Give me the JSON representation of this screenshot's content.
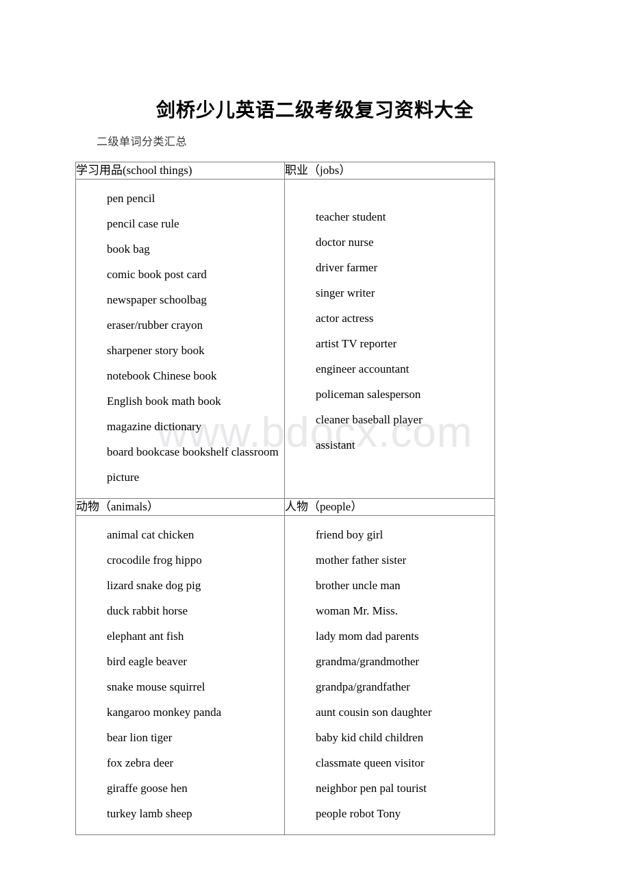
{
  "document": {
    "title": "剑桥少儿英语二级考级复习资料大全",
    "subtitle": "二级单词分类汇总",
    "watermark": "www.bdocx.com"
  },
  "table": {
    "sections": [
      {
        "left": {
          "heading": "学习用品(school things)",
          "words": [
            "pen    pencil",
            "pencil case        rule",
            "book        bag",
            "comic book post card",
            "newspaper     schoolbag",
            "eraser/rubber     crayon",
            "sharpener     story book",
            "notebook Chinese book",
            "English book math book",
            "magazine dictionary",
            "board bookcase bookshelf classroom picture"
          ]
        },
        "right": {
          "heading": "职业（jobs）",
          "words": [
            "teacher    student",
            "doctor    nurse",
            "driver    farmer",
            "singer writer",
            "actor    actress",
            "artist    TV reporter",
            "engineer     accountant",
            "policeman salesperson",
            "cleaner     baseball player",
            "assistant"
          ]
        }
      },
      {
        "left": {
          "heading": "动物（animals）",
          "words": [
            "animal cat    chicken",
            "crocodile frog hippo",
            "lizard snake dog pig",
            "duck rabbit    horse",
            "elephant    ant fish",
            "bird    eagle    beaver",
            "snake mouse    squirrel",
            "kangaroo monkey panda",
            "bear    lion    tiger",
            "fox    zebra    deer",
            "giraffe    goose    hen",
            "turkey    lamb    sheep"
          ]
        },
        "right": {
          "heading": "人物（people）",
          "words": [
            "friend    boy    girl",
            "mother    father sister",
            "brother    uncle    man",
            "woman    Mr.    Miss.",
            "lady    mom    dad parents",
            "grandma/grandmother",
            "grandpa/grandfather",
            "aunt cousin    son daughter",
            "baby kid    child children",
            "classmate queen visitor",
            "neighbor     pen pal    tourist",
            "people    robot Tony"
          ]
        }
      }
    ]
  }
}
